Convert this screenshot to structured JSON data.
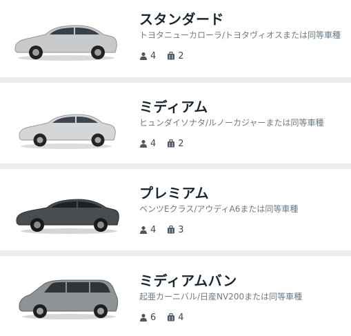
{
  "cars": [
    {
      "class_name": "スタンダード",
      "models": "トヨタニューカローラ/トヨタヴィオスまたは同等車種",
      "passengers": "4",
      "luggage": "2",
      "icons": {
        "passengers": "person-icon",
        "luggage": "suitcase-icon"
      },
      "car_color": "#c7c9cb"
    },
    {
      "class_name": "ミディアム",
      "models": "ヒュンダイソナタ/ルノーカジャーまたは同等車種",
      "passengers": "4",
      "luggage": "2",
      "icons": {
        "passengers": "person-icon",
        "luggage": "suitcase-icon"
      },
      "car_color": "#d4d6d8"
    },
    {
      "class_name": "プレミアム",
      "models": "ベンツEクラス/アウディA6または同等車種",
      "passengers": "4",
      "luggage": "3",
      "icons": {
        "passengers": "person-icon",
        "luggage": "suitcase-icon"
      },
      "car_color": "#4a4d50"
    },
    {
      "class_name": "ミディアムバン",
      "models": "起亜カーニバル/日産NV200または同等車種",
      "passengers": "6",
      "luggage": "4",
      "icons": {
        "passengers": "person-icon",
        "luggage": "suitcase-icon"
      },
      "car_color": "#8e9496"
    }
  ]
}
